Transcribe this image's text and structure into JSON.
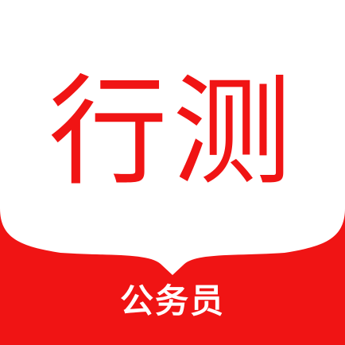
{
  "icon": {
    "title": "行测",
    "subtitle": "公务员",
    "colors": {
      "accent": "#f01414",
      "background": "#ffffff",
      "subtitle_text": "#ffffff"
    }
  }
}
